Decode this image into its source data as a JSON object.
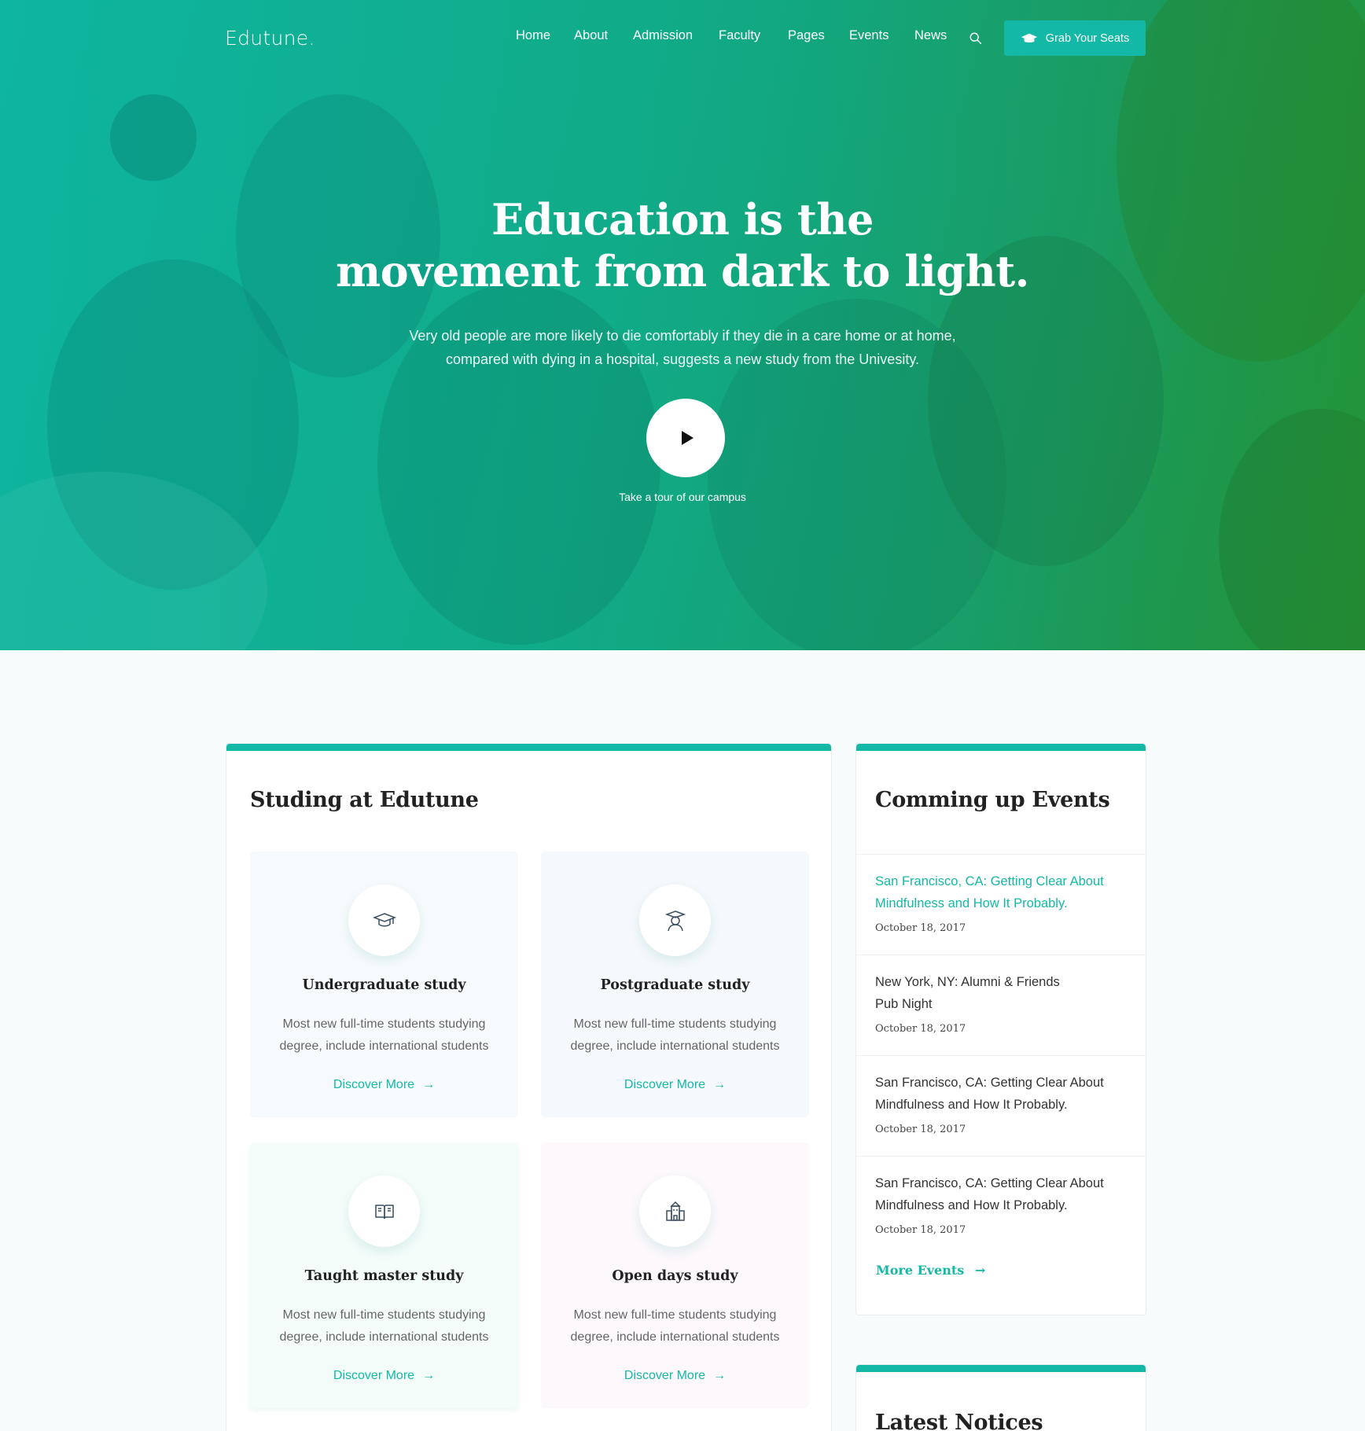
{
  "brand": {
    "logo": "Edutune.",
    "accent": "#14b8a6"
  },
  "nav": {
    "items": [
      "Home",
      "About",
      "Admission",
      "Faculty",
      "Pages",
      "Events",
      "News"
    ],
    "cta_label": "Grab Your Seats",
    "search_icon": "search-icon"
  },
  "hero": {
    "title_line1": "Education is the",
    "title_line2": "movement from dark to light.",
    "subtitle_line1": "Very old people are more likely to die comfortably if they die in a care home or at home,",
    "subtitle_line2": "compared with dying in a hospital, suggests a new study from the Univesity.",
    "play_caption": "Take a tour of our campus"
  },
  "study": {
    "title": "Studing at Edutune",
    "cards": [
      {
        "title": "Undergraduate study",
        "text": "Most new full-time students studying degree, include international students",
        "link": "Discover More",
        "icon": "graduation-cap-icon",
        "bg": "#f7fafc"
      },
      {
        "title": "Postgraduate  study",
        "text": "Most new full-time students studying degree, include international students",
        "link": "Discover More",
        "icon": "graduate-student-icon",
        "bg": "#f5f8fc"
      },
      {
        "title": "Taught master study",
        "text": "Most new full-time students studying degree, include international students",
        "link": "Discover More",
        "icon": "open-book-icon",
        "bg": "#f4fcfa"
      },
      {
        "title": "Open days study",
        "text": "Most new full-time students studying degree, include international students",
        "link": "Discover More",
        "icon": "building-icon",
        "bg": "#fcf8fc"
      }
    ]
  },
  "events": {
    "title": "Comming up Events",
    "items": [
      {
        "line1": "San Francisco, CA: Getting Clear About",
        "line2": "Mindfulness and How It Probably.",
        "date": "October 18, 2017",
        "active": true
      },
      {
        "line1": "New York, NY: Alumni & Friends",
        "line2": "Pub Night",
        "date": "October 18, 2017",
        "active": false
      },
      {
        "line1": "San Francisco, CA: Getting Clear About",
        "line2": "Mindfulness and How It Probably.",
        "date": "October 18, 2017",
        "active": false
      },
      {
        "line1": "San Francisco, CA: Getting Clear About",
        "line2": "Mindfulness and How It Probably.",
        "date": "October 18, 2017",
        "active": false
      }
    ],
    "more_label": "More Events"
  },
  "notices": {
    "title": "Latest Notices"
  }
}
